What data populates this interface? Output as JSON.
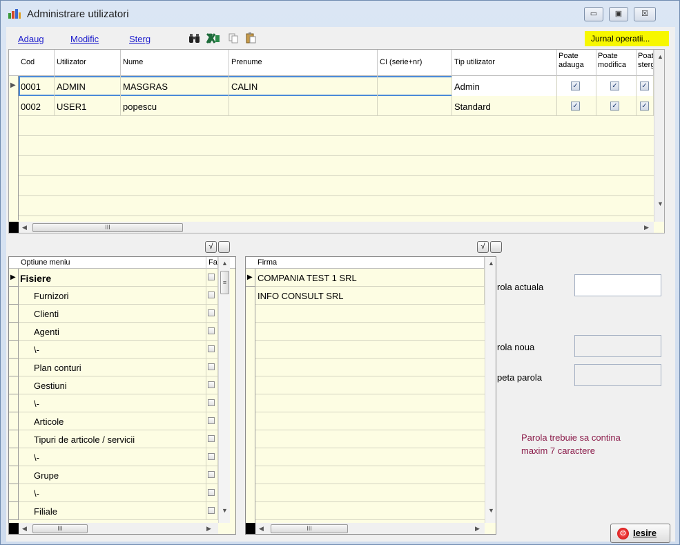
{
  "window": {
    "title": "Administrare utilizatori",
    "min_glyph": "▭",
    "max_glyph": "▣",
    "close_glyph": "☒"
  },
  "toolbar": {
    "add": "Adaug",
    "modify": "Modific",
    "delete": "Sterg",
    "find_icon": "binoculars-icon",
    "excel_icon": "excel-icon",
    "copy_icon": "copy-icon",
    "paste_icon": "paste-icon",
    "jurnal": "Jurnal operatii..."
  },
  "users_grid": {
    "columns": [
      "Cod",
      "Utilizator",
      "Nume",
      "Prenume",
      "CI (serie+nr)",
      "Tip utilizator"
    ],
    "perm_columns": [
      {
        "l1": "Poate",
        "l2": "adauga"
      },
      {
        "l1": "Poate",
        "l2": "modifica"
      },
      {
        "l1": "Poat",
        "l2": "sterg"
      }
    ],
    "rows": [
      {
        "cod": "0001",
        "utilizator": "ADMIN",
        "nume": "MASGRAS",
        "prenume": "CALIN",
        "ci": "",
        "tip": "Admin",
        "adauga": true,
        "modifica": true,
        "sterge": true
      },
      {
        "cod": "0002",
        "utilizator": "USER1",
        "nume": "popescu",
        "prenume": "",
        "ci": "",
        "tip": "Standard",
        "adauga": true,
        "modifica": true,
        "sterge": true
      }
    ],
    "scroll_thumb": "III"
  },
  "menu_grid": {
    "col_option": "Optiune meniu",
    "col_flag": "Fa",
    "check_all": "√",
    "uncheck_all": "",
    "items": [
      "Fisiere",
      "Furnizori",
      "Clienti",
      "Agenti",
      "\\-",
      "Plan conturi",
      "Gestiuni",
      "\\-",
      "Articole",
      "Tipuri de articole / servicii",
      "\\-",
      "Grupe",
      "\\-",
      "Filiale"
    ],
    "scroll_thumb": "III",
    "vthumb": "≡"
  },
  "firm_grid": {
    "col_firma": "Firma",
    "check_all": "√",
    "uncheck_all": "",
    "items": [
      "COMPANIA TEST 1 SRL",
      "INFO CONSULT SRL"
    ],
    "scroll_thumb": "III"
  },
  "password": {
    "actual": "rola actuala",
    "noua": "rola noua",
    "repeta": "peta parola",
    "actual_value": "",
    "noua_value": "",
    "repeta_value": "",
    "note_line1": "Parola trebuie sa contina",
    "note_line2": "maxim 7 caractere"
  },
  "exit": {
    "label": "Iesire",
    "icon": "power-icon"
  },
  "colors": {
    "highlight": "#f7f700",
    "grid_bg": "#fdfde3",
    "note": "#8b1c4a",
    "link": "#1a1acc"
  }
}
